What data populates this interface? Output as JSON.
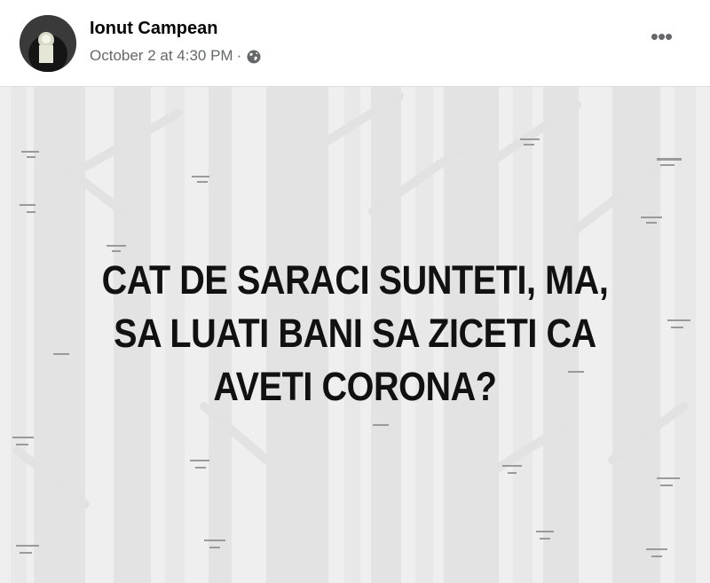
{
  "post": {
    "author": "Ionut Campean",
    "timestamp": "October 2 at 4:30 PM",
    "separator": "·",
    "privacy_icon": "globe-icon",
    "more_icon": "more-options-icon",
    "more_label": "•••"
  },
  "image": {
    "text_lines": [
      "CAT DE SARACI SUNTETI, MA,",
      "SA LUATI BANI SA ZICETI CA",
      "AVETI CORONA?"
    ]
  },
  "colors": {
    "author_text": "#050505",
    "secondary_text": "#65676b",
    "image_background": "#efefef",
    "tree_trunk": "#e4e4e4",
    "caption_text": "#111111"
  }
}
